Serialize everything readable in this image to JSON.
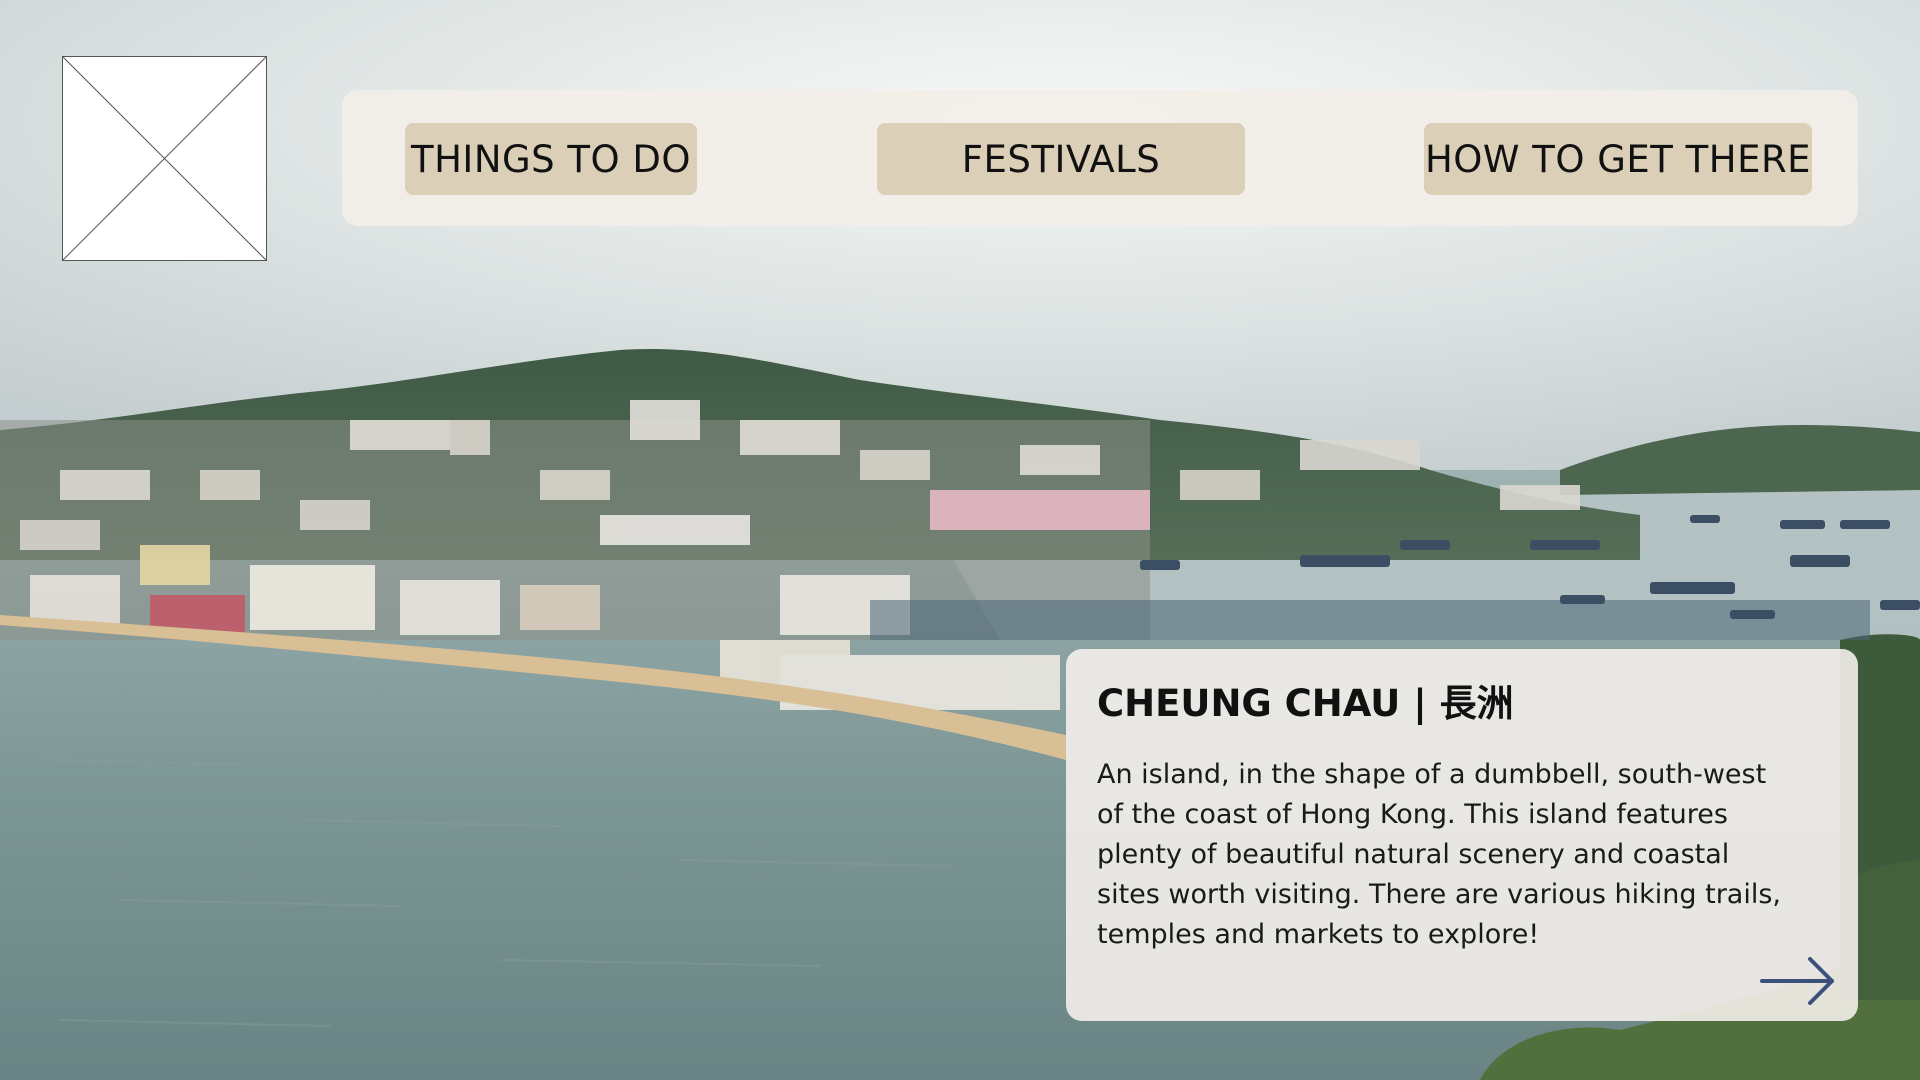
{
  "background": {
    "description_icon": "island-harbour-photo"
  },
  "logo": {
    "icon": "image-placeholder-icon"
  },
  "nav": {
    "items": [
      {
        "label": "THINGS TO DO"
      },
      {
        "label": "FESTIVALS"
      },
      {
        "label": "HOW TO GET THERE"
      }
    ]
  },
  "card": {
    "title": "CHEUNG CHAU | 長洲",
    "body": "An island, in the shape of a dumbbell, south-west of the coast of Hong Kong. This island features plenty of beautiful natural scenery and coastal sites worth visiting. There are various hiking trails, temples and markets to explore!",
    "arrow_icon": "arrow-right-icon",
    "arrow_color": "#3d4f7c"
  },
  "colors": {
    "nav_panel": "#f2eee8",
    "nav_button": "#dccfb8",
    "card_panel": "#f4f0eb"
  }
}
